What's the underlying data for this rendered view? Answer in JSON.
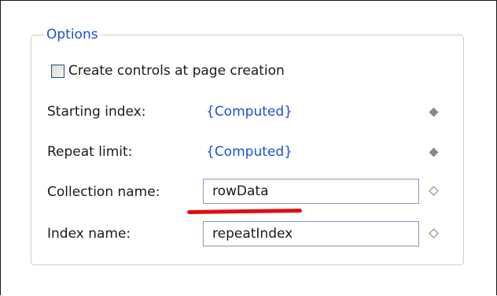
{
  "options_group": {
    "title": "Options",
    "create_controls": {
      "label": "Create controls at page creation",
      "checked": false
    },
    "starting_index": {
      "label": "Starting index:",
      "value": "{Computed}",
      "indicator_icon": "filled-diamond-icon"
    },
    "repeat_limit": {
      "label": "Repeat limit:",
      "value": "{Computed}",
      "indicator_icon": "filled-diamond-icon"
    },
    "collection_name": {
      "label": "Collection name:",
      "value": "rowData",
      "indicator_icon": "hollow-diamond-icon"
    },
    "index_name": {
      "label": "Index name:",
      "value": "repeatIndex",
      "indicator_icon": "hollow-diamond-icon"
    }
  },
  "colors": {
    "legend": "#1f4fd0",
    "link_value": "#1f4fd0",
    "highlight_underline": "#e01010",
    "diamond_filled": "#8a8a8a",
    "diamond_hollow": "#9a9a9a"
  }
}
